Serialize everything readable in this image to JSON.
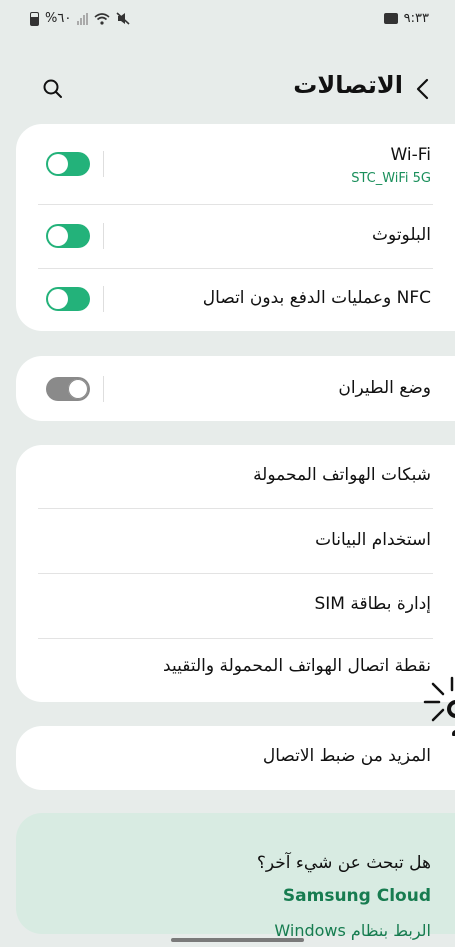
{
  "status_bar": {
    "battery": "%٦٠",
    "time": "٩:٣٣"
  },
  "header": {
    "title": "الاتصالات"
  },
  "card1": {
    "wifi_label": "Wi-Fi",
    "wifi_network": "STC_WiFi 5G",
    "wifi_on": true,
    "bluetooth_label": "البلوتوث",
    "bluetooth_on": true,
    "nfc_label": "NFC وعمليات الدفع بدون اتصال",
    "nfc_on": true
  },
  "card2": {
    "airplane_label": "وضع الطيران",
    "airplane_on": false
  },
  "card3": {
    "items": [
      "شبكات الهواتف المحمولة",
      "استخدام البيانات",
      "إدارة بطاقة SIM",
      "نقطة اتصال الهواتف المحمولة والتقييد"
    ]
  },
  "card4": {
    "more_label": "المزيد من ضبط الاتصال"
  },
  "suggestions": {
    "title": "هل تبحث عن شيء آخر؟",
    "link1": "Samsung Cloud",
    "link2": "الربط بنظام Windows"
  },
  "colors": {
    "accent": "#23b27a",
    "link": "#177c50",
    "background": "#e7ecea",
    "suggest_bg": "#d8ebe2"
  }
}
